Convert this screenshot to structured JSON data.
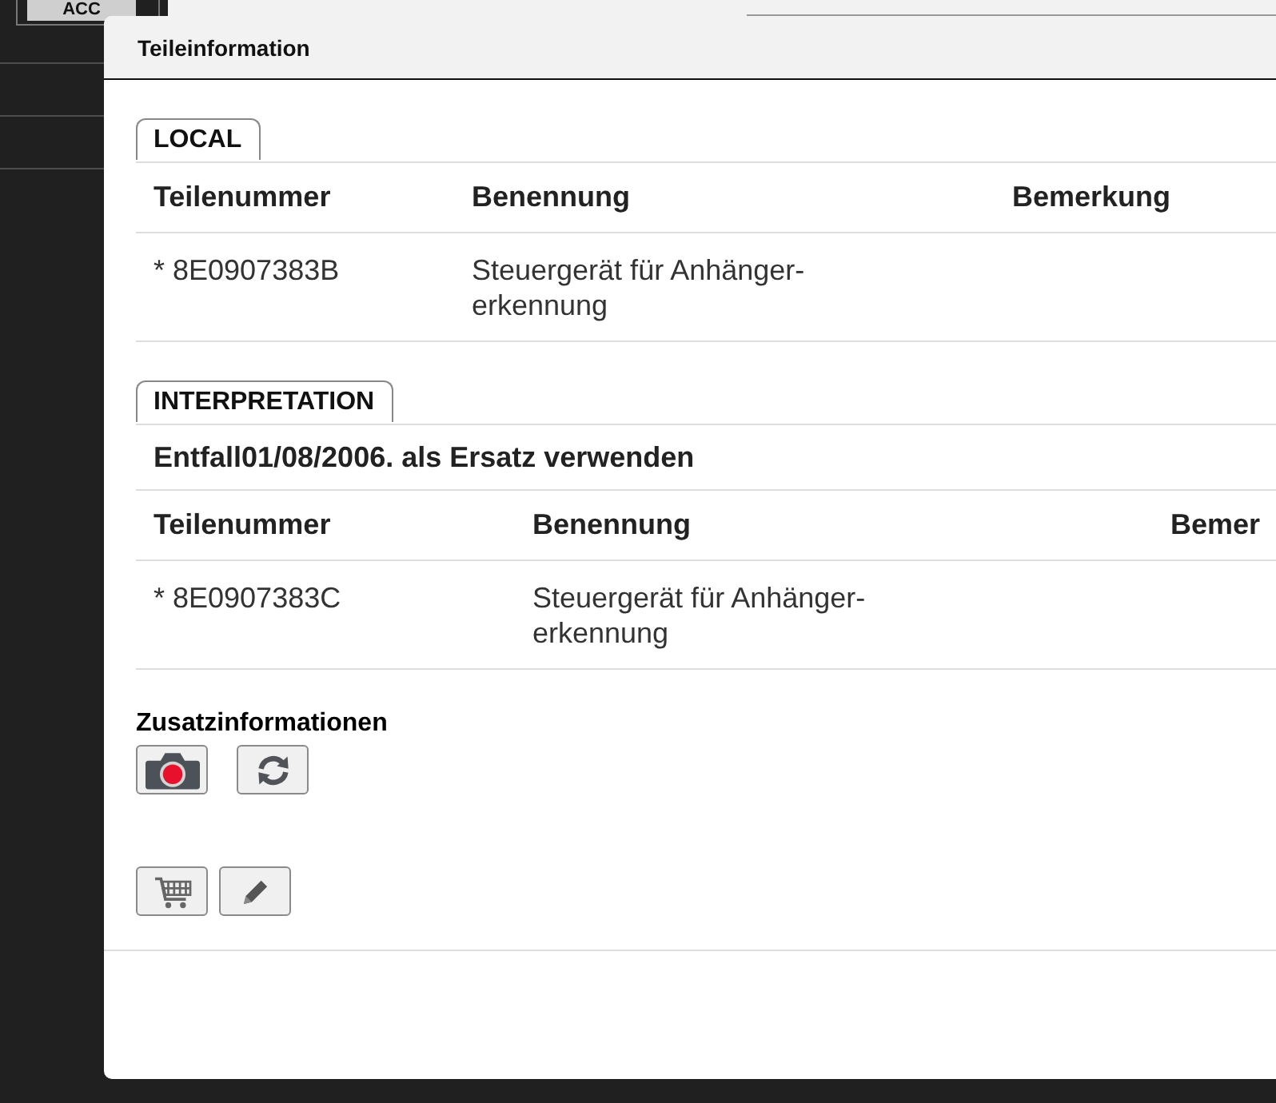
{
  "background": {
    "button": "ACC"
  },
  "dialog": {
    "title": "Teileinformation",
    "sections": [
      {
        "tab": "LOCAL",
        "columns": [
          "Teilenummer",
          "Benennung",
          "Bemerkung"
        ],
        "rows": [
          {
            "cells": [
              "* 8E0907383B",
              "Steuergerät für Anhänger-erkennung"
            ]
          }
        ]
      },
      {
        "tab": "INTERPRETATION",
        "note": "Entfall01/08/2006. als Ersatz verwenden",
        "columns": [
          "Teilenummer",
          "Benennung",
          "Bemer"
        ],
        "rows": [
          {
            "cells": [
              "* 8E0907383C",
              "Steuergerät für Anhänger-erkennung"
            ]
          }
        ]
      }
    ],
    "extra": {
      "title": "Zusatzinformationen",
      "tools": [
        {
          "kind": "camera"
        },
        {
          "kind": "refresh"
        }
      ]
    },
    "actions": [
      {
        "kind": "cart"
      },
      {
        "kind": "pencil"
      }
    ]
  }
}
